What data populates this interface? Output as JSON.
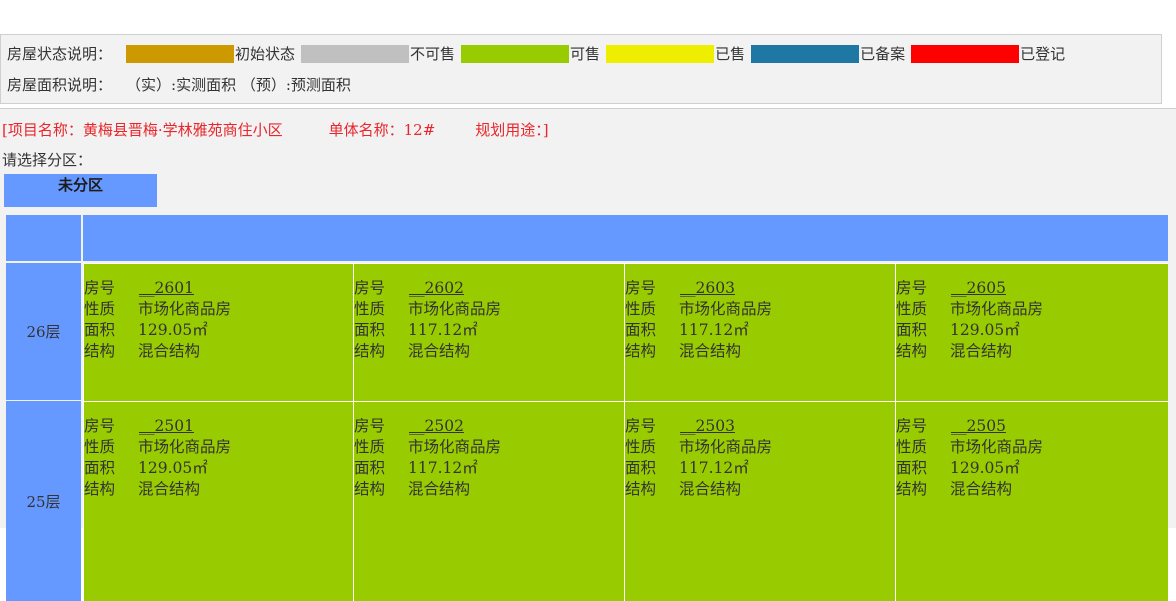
{
  "legend": {
    "status_title": "房屋状态说明：",
    "statuses": [
      {
        "label": "初始状态",
        "color": "#cc9900"
      },
      {
        "label": "不可售",
        "color": "#c0c0c0"
      },
      {
        "label": "可售",
        "color": "#99cc00"
      },
      {
        "label": "已售",
        "color": "#eeee00"
      },
      {
        "label": "已备案",
        "color": "#1f77a3"
      },
      {
        "label": "已登记",
        "color": "#ff0000"
      }
    ],
    "area_title": "房屋面积说明：",
    "area_note": "（实）:实测面积 （预）:预测面积"
  },
  "project": {
    "name_text": "[项目名称：黄梅县晋梅·学林雅苑商住小区",
    "building_text": "单体名称：12#",
    "usage_text": "规划用途：]"
  },
  "zone": {
    "choose_label": "请选择分区：",
    "selected": "未分区"
  },
  "field_labels": {
    "room": "房号",
    "nature": "性质",
    "area": "面积",
    "structure": "结构"
  },
  "floors": [
    {
      "label": "26层",
      "units": [
        {
          "room": "__2601",
          "nature": "市场化商品房",
          "area": "129.05㎡",
          "structure": "混合结构"
        },
        {
          "room": "__2602",
          "nature": "市场化商品房",
          "area": "117.12㎡",
          "structure": "混合结构"
        },
        {
          "room": "__2603",
          "nature": "市场化商品房",
          "area": "117.12㎡",
          "structure": "混合结构"
        },
        {
          "room": "__2605",
          "nature": "市场化商品房",
          "area": "129.05㎡",
          "structure": "混合结构"
        }
      ]
    },
    {
      "label": "25层",
      "units": [
        {
          "room": "__2501",
          "nature": "市场化商品房",
          "area": "129.05㎡",
          "structure": "混合结构"
        },
        {
          "room": "__2502",
          "nature": "市场化商品房",
          "area": "117.12㎡",
          "structure": "混合结构"
        },
        {
          "room": "__2503",
          "nature": "市场化商品房",
          "area": "117.12㎡",
          "structure": "混合结构"
        },
        {
          "room": "__2505",
          "nature": "市场化商品房",
          "area": "129.05㎡",
          "structure": "混合结构"
        }
      ]
    }
  ]
}
